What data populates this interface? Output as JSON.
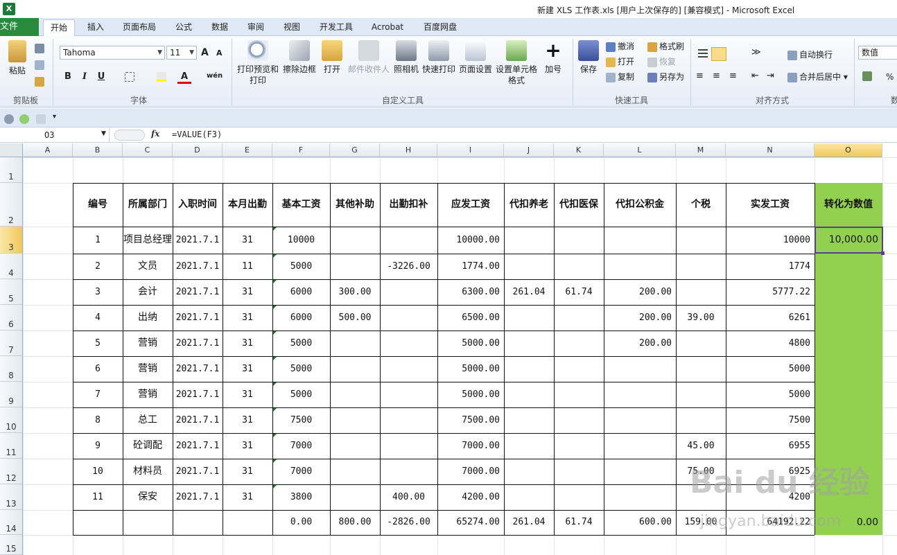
{
  "window": {
    "title": "新建 XLS 工作表.xls [用户上次保存的]  [兼容模式]  -  Microsoft Excel"
  },
  "tabs": {
    "file": "文件",
    "items": [
      "开始",
      "插入",
      "页面布局",
      "公式",
      "数据",
      "审阅",
      "视图",
      "开发工具",
      "Acrobat",
      "百度网盘"
    ]
  },
  "ribbon": {
    "clipboard": {
      "paste": "粘贴",
      "label": "剪贴板"
    },
    "font": {
      "name": "Tahoma",
      "size": "11",
      "label": "字体",
      "bold": "B",
      "italic": "I",
      "underline": "U",
      "grow": "A",
      "shrink": "A",
      "wen": "wén"
    },
    "custom": {
      "label": "自定义工具",
      "buttons": [
        "打印预览和打印",
        "擦除边框",
        "打开",
        "邮件收件人",
        "照相机",
        "快速打印",
        "页面设置",
        "设置单元格格式",
        "加号"
      ]
    },
    "quick": {
      "label": "快速工具",
      "save": "保存",
      "undo": "撤消",
      "redo": "恢复",
      "open": "打开",
      "copy": "复制",
      "painter": "格式刷",
      "saveas": "另存为"
    },
    "align": {
      "label": "对齐方式",
      "wrap": "自动换行",
      "merge": "合并后居中"
    },
    "number": {
      "format": "数值",
      "label": "数",
      "percent": "%"
    }
  },
  "formula_bar": {
    "name_box": "O3",
    "fx": "fx",
    "formula": "=VALUE(F3)"
  },
  "columns": [
    "A",
    "B",
    "C",
    "D",
    "E",
    "F",
    "G",
    "H",
    "I",
    "J",
    "K",
    "L",
    "M",
    "N",
    "O"
  ],
  "rows": [
    "1",
    "2",
    "3",
    "4",
    "5",
    "6",
    "7",
    "8",
    "9",
    "10",
    "11",
    "12",
    "13",
    "14",
    "15"
  ],
  "table": {
    "headers": [
      "编号",
      "所属部门",
      "入职时间",
      "本月出勤",
      "基本工资",
      "其他补助",
      "出勤扣补",
      "应发工资",
      "代扣养老",
      "代扣医保",
      "代扣公积金",
      "个税",
      "实发工资",
      "转化为数值"
    ],
    "rows": [
      [
        "1",
        "项目总经理",
        "2021.7.1",
        "31",
        "10000",
        "",
        "",
        "10000.00",
        "",
        "",
        "",
        "",
        "10000",
        "10,000.00"
      ],
      [
        "2",
        "文员",
        "2021.7.1",
        "11",
        "5000",
        "",
        "-3226.00",
        "1774.00",
        "",
        "",
        "",
        "",
        "1774",
        ""
      ],
      [
        "3",
        "会计",
        "2021.7.1",
        "31",
        "6000",
        "300.00",
        "",
        "6300.00",
        "261.04",
        "61.74",
        "200.00",
        "",
        "5777.22",
        ""
      ],
      [
        "4",
        "出纳",
        "2021.7.1",
        "31",
        "6000",
        "500.00",
        "",
        "6500.00",
        "",
        "",
        "200.00",
        "39.00",
        "6261",
        ""
      ],
      [
        "5",
        "营销",
        "2021.7.1",
        "31",
        "5000",
        "",
        "",
        "5000.00",
        "",
        "",
        "200.00",
        "",
        "4800",
        ""
      ],
      [
        "6",
        "营销",
        "2021.7.1",
        "31",
        "5000",
        "",
        "",
        "5000.00",
        "",
        "",
        "",
        "",
        "5000",
        ""
      ],
      [
        "7",
        "营销",
        "2021.7.1",
        "31",
        "5000",
        "",
        "",
        "5000.00",
        "",
        "",
        "",
        "",
        "5000",
        ""
      ],
      [
        "8",
        "总工",
        "2021.7.1",
        "31",
        "7500",
        "",
        "",
        "7500.00",
        "",
        "",
        "",
        "",
        "7500",
        ""
      ],
      [
        "9",
        "砼调配",
        "2021.7.1",
        "31",
        "7000",
        "",
        "",
        "7000.00",
        "",
        "",
        "",
        "45.00",
        "6955",
        ""
      ],
      [
        "10",
        "材料员",
        "2021.7.1",
        "31",
        "7000",
        "",
        "",
        "7000.00",
        "",
        "",
        "",
        "75.00",
        "6925",
        ""
      ],
      [
        "11",
        "保安",
        "2021.7.1",
        "31",
        "3800",
        "",
        "400.00",
        "4200.00",
        "",
        "",
        "",
        "",
        "4200",
        ""
      ],
      [
        "",
        "",
        "",
        "",
        "0.00",
        "800.00",
        "-2826.00",
        "65274.00",
        "261.04",
        "61.74",
        "600.00",
        "159.00",
        "64192.22",
        "0.00"
      ]
    ]
  },
  "watermark": {
    "brand": "Bai du 经验",
    "url": "jingyan.baidu.com"
  },
  "colors": {
    "file_tab": "#2a8a3e",
    "highlight": "#92d050",
    "active_border": "#5a3a8a"
  }
}
